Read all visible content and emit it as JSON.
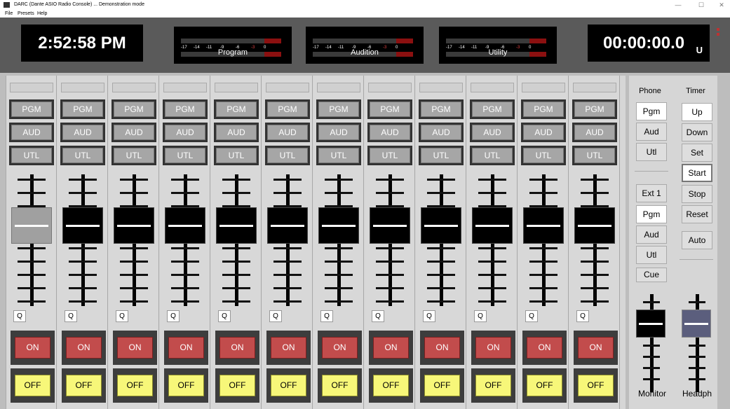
{
  "window": {
    "title": "DARC   (Dante ASIO Radio Console) ... Demonstration mode",
    "min": "—",
    "max": "☐",
    "close": "✕"
  },
  "menu": [
    "File",
    "Presets",
    "Help"
  ],
  "header": {
    "clock": "2:52:58 PM",
    "timer": "00:00:00.0",
    "timer_unit": "U",
    "meter_scale": [
      "-17",
      "-14",
      "-11",
      "-9",
      "-6",
      "-3",
      "0"
    ],
    "meters": [
      "Program",
      "Audition",
      "Utility"
    ]
  },
  "channels": {
    "count": 12,
    "bus_labels": [
      "PGM",
      "AUD",
      "UTL"
    ],
    "q_label": "Q",
    "on_label": "ON",
    "off_label": "OFF",
    "fader_levels": [
      0.5,
      0.5,
      0.5,
      0.5,
      0.5,
      0.5,
      0.5,
      0.5,
      0.5,
      0.5,
      0.5,
      0.5
    ]
  },
  "phone": {
    "title": "Phone",
    "buttons": [
      "Pgm",
      "Aud",
      "Utl"
    ]
  },
  "ext": {
    "buttons": [
      "Ext 1",
      "Pgm",
      "Aud",
      "Utl",
      "Cue"
    ]
  },
  "timer": {
    "title": "Timer",
    "buttons": [
      "Up",
      "Down",
      "Set",
      "Start",
      "Stop",
      "Reset",
      "Auto"
    ]
  },
  "faders": {
    "monitor": "Monitor",
    "headphone": "Headph"
  },
  "colors": {
    "on": "#c24c4c",
    "off": "#f7f779",
    "meter_peak": "#8b1010"
  }
}
